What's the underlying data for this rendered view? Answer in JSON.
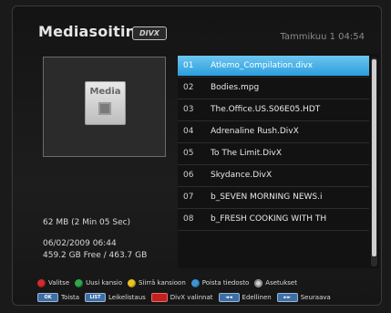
{
  "header": {
    "title": "Mediasoitin",
    "logo_text": "DIVX",
    "datetime": "Tammikuu 1 04:54"
  },
  "preview": {
    "icon_label": "Media",
    "file_size": "62 MB (2 Min 05 Sec)",
    "date": "06/02/2009 06:44",
    "disk": "459.2 GB Free / 463.7 GB"
  },
  "file_list": {
    "items": [
      {
        "num": "01",
        "name": "Atlemo_Compilation.divx",
        "selected": true
      },
      {
        "num": "02",
        "name": "Bodies.mpg",
        "selected": false
      },
      {
        "num": "03",
        "name": "The.Office.US.S06E05.HDT",
        "selected": false
      },
      {
        "num": "04",
        "name": "Adrenaline Rush.DivX",
        "selected": false
      },
      {
        "num": "05",
        "name": "To The Limit.DivX",
        "selected": false
      },
      {
        "num": "06",
        "name": "Skydance.DivX",
        "selected": false
      },
      {
        "num": "07",
        "name": "b_SEVEN MORNING NEWS.i",
        "selected": false
      },
      {
        "num": "08",
        "name": "b_FRESH COOKING WITH TH",
        "selected": false
      }
    ]
  },
  "legend": {
    "row1": [
      {
        "color": "#d42a2a",
        "label": "Valitse",
        "icon": "red-dot-icon"
      },
      {
        "color": "#2fa84a",
        "label": "Uusi kansio",
        "icon": "green-dot-icon"
      },
      {
        "color": "#e8c21f",
        "label": "Siirrä kansioon",
        "icon": "yellow-dot-icon"
      },
      {
        "color": "#3a96d4",
        "label": "Poista tiedosto",
        "icon": "blue-dot-icon"
      },
      {
        "color": "#cccccc",
        "label": "Asetukset",
        "icon": "gear-icon"
      }
    ],
    "row2": [
      {
        "key": "OK",
        "label": "Toista"
      },
      {
        "key": "LIST",
        "label": "Leikelistaus"
      },
      {
        "key": "",
        "label": "DivX valinnat",
        "red": true
      },
      {
        "key": "◄◄",
        "label": "Edellinen"
      },
      {
        "key": "►►",
        "label": "Seuraava"
      }
    ]
  },
  "colors": {
    "selection": "#2a9ede",
    "background": "#1a1a1a"
  }
}
